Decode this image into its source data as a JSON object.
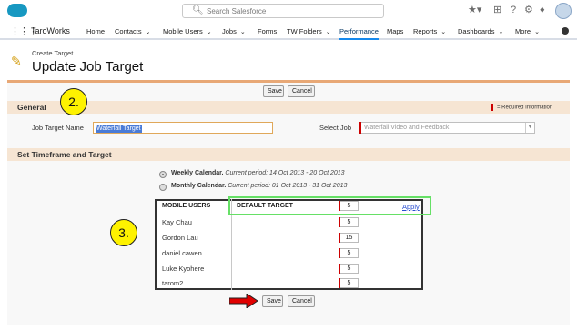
{
  "header": {
    "search_placeholder": "Search Salesforce",
    "icons": [
      "favorites-icon",
      "add-icon",
      "help-icon",
      "setup-gear-icon",
      "notifications-bell-icon",
      "user-avatar"
    ]
  },
  "nav": {
    "app_name": "TaroWorks",
    "items": [
      {
        "label": "Home",
        "chevron": false,
        "active": false
      },
      {
        "label": "Contacts",
        "chevron": true,
        "active": false
      },
      {
        "label": "Mobile Users",
        "chevron": true,
        "active": false
      },
      {
        "label": "Jobs",
        "chevron": true,
        "active": false
      },
      {
        "label": "Forms",
        "chevron": false,
        "active": false
      },
      {
        "label": "TW Folders",
        "chevron": true,
        "active": false
      },
      {
        "label": "Performance",
        "chevron": false,
        "active": true
      },
      {
        "label": "Maps",
        "chevron": false,
        "active": false
      },
      {
        "label": "Reports",
        "chevron": true,
        "active": false
      },
      {
        "label": "Dashboards",
        "chevron": true,
        "active": false
      },
      {
        "label": "More",
        "chevron": true,
        "active": false
      }
    ]
  },
  "page": {
    "pre_title": "Create Target",
    "title": "Update Job Target"
  },
  "buttons": {
    "save": "Save",
    "cancel": "Cancel"
  },
  "general": {
    "section_title": "General",
    "required_info": "= Required Information",
    "job_target_name_label": "Job Target Name",
    "job_target_name_value": "Waterfall Target",
    "select_job_label": "Select Job",
    "select_job_value": "Waterfall Video and Feedback"
  },
  "timeframe": {
    "section_title": "Set Timeframe and Target",
    "options": [
      {
        "name": "Weekly Calendar.",
        "period": "Current period: 14 Oct 2013 - 20 Oct 2013",
        "selected": true
      },
      {
        "name": "Monthly Calendar.",
        "period": "Current period: 01 Oct 2013 - 31 Oct 2013",
        "selected": false
      }
    ]
  },
  "targets_table": {
    "col_users": "MOBILE USERS",
    "col_default": "DEFAULT TARGET",
    "default_value": "5",
    "apply_label": "Apply",
    "rows": [
      {
        "user": "Kay Chau",
        "target": "5"
      },
      {
        "user": "Gordon Lau",
        "target": "15"
      },
      {
        "user": "daniel cawen",
        "target": "5"
      },
      {
        "user": "Luke Kyohere",
        "target": "5"
      },
      {
        "user": "tarom2",
        "target": "5"
      }
    ]
  },
  "annotations": {
    "badge_2": "2.",
    "badge_3": "3.",
    "badge_color": "#fef200",
    "highlight_color": "#66e066",
    "arrow_color": "#e00000"
  }
}
